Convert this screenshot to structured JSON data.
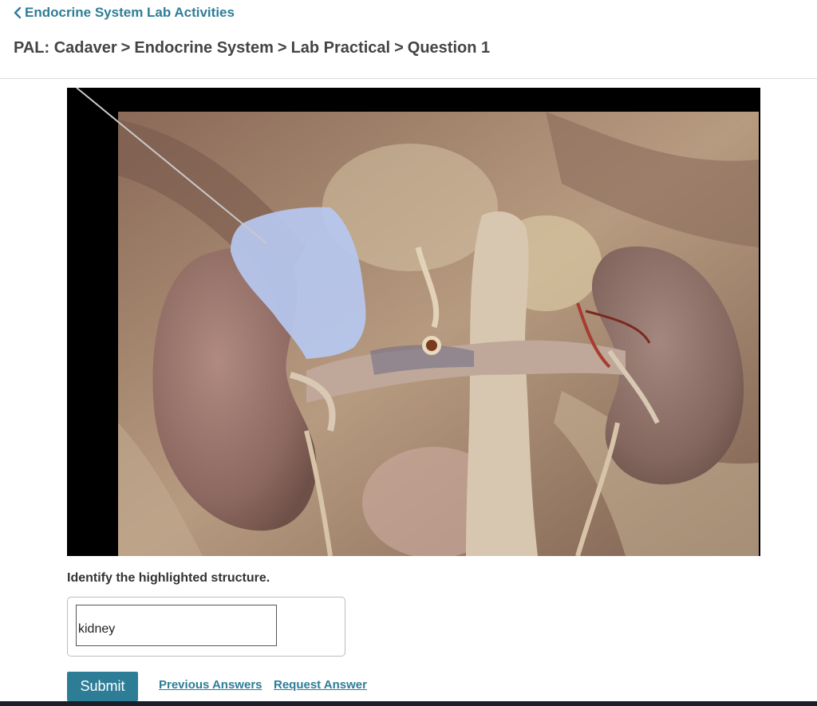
{
  "header": {
    "back_link_label": "Endocrine System Lab Activities",
    "breadcrumb": [
      "PAL: Cadaver",
      "Endocrine System",
      "Lab Practical",
      "Question 1"
    ],
    "breadcrumb_separator": ">"
  },
  "figure": {
    "highlight_color": "#b6c8f0",
    "background_color": "#000000"
  },
  "question": {
    "prompt": "Identify the highlighted structure.",
    "answer_value": "kidney"
  },
  "actions": {
    "submit_label": "Submit",
    "previous_answers_label": "Previous Answers",
    "request_answer_label": "Request Answer"
  },
  "colors": {
    "accent": "#2e7d97",
    "text": "#333333"
  }
}
